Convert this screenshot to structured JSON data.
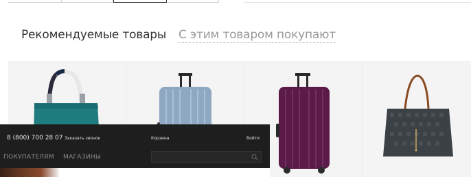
{
  "recommended": {
    "active_tab": "Рекомендуемые товары",
    "alt_tab": "С этим товаром покупают"
  },
  "products": [
    {
      "name": "teal-tote-bag",
      "icon": "teal-handbag"
    },
    {
      "name": "light-blue-suitcase",
      "icon": "silver-blue-suitcase"
    },
    {
      "name": "purple-suitcase",
      "icon": "purple-suitcase"
    },
    {
      "name": "dark-tote-bag",
      "icon": "checkered-tote"
    }
  ],
  "header": {
    "phone": "8 (800) 700 28 07",
    "callback": "Заказать звонок",
    "cart": "Корзина",
    "login": "Войти",
    "nav": [
      "ПОКУПАТЕЛЯМ",
      "МАГАЗИНЫ"
    ],
    "search_placeholder": ""
  },
  "colors": {
    "header_bg": "#1e1e1e",
    "tile_bg": "#f4f4f4",
    "teal": "#1f7d80",
    "purple": "#5a1a4a",
    "light_blue": "#8fa8c2"
  }
}
